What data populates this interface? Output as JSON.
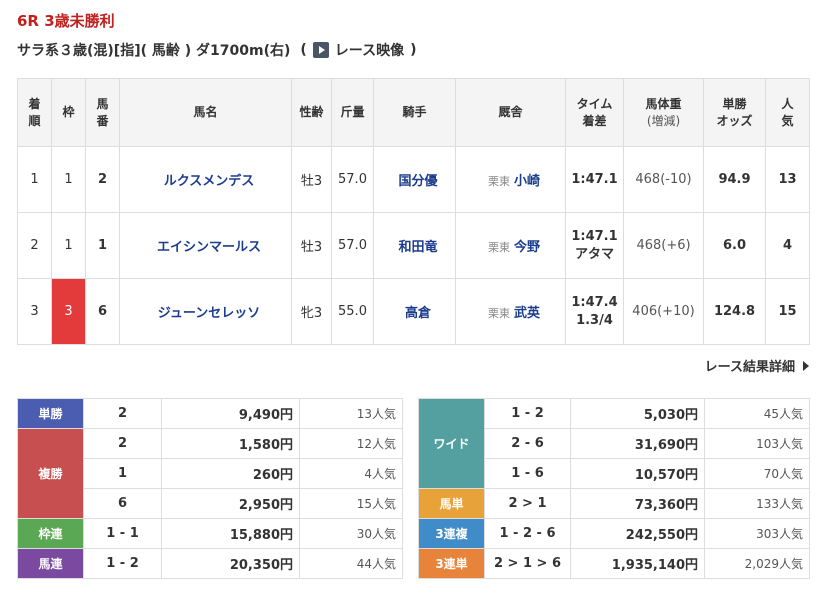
{
  "race": {
    "title": "6R 3歳未勝利",
    "conditions": "サラ系３歳(混)[指]( 馬齢 ) ダ1700m(右)",
    "paren_open": "(",
    "video_label": "レース映像",
    "paren_close": ")"
  },
  "results_table": {
    "headers": {
      "rank_1": "着",
      "rank_2": "順",
      "waku": "枠",
      "uma_1": "馬",
      "uma_2": "番",
      "horse": "馬名",
      "sexage": "性齢",
      "kinryo": "斤量",
      "jockey": "騎手",
      "trainer": "厩舎",
      "time_1": "タイム",
      "time_2": "着差",
      "weight_1": "馬体重",
      "weight_2": "(増減)",
      "odds_1": "単勝",
      "odds_2": "オッズ",
      "pop_1": "人",
      "pop_2": "気"
    },
    "rows": [
      {
        "rank": "1",
        "waku": "1",
        "uma": "2",
        "horse": "ルクスメンデス",
        "sexage": "牡3",
        "kinryo": "57.0",
        "jockey": "国分優",
        "trainer_area": "栗東",
        "trainer": "小崎",
        "time": "1:47.1",
        "margin": "",
        "weight": "468(-10)",
        "odds": "94.9",
        "pop": "13"
      },
      {
        "rank": "2",
        "waku": "1",
        "uma": "1",
        "horse": "エイシンマールス",
        "sexage": "牡3",
        "kinryo": "57.0",
        "jockey": "和田竜",
        "trainer_area": "栗東",
        "trainer": "今野",
        "time": "1:47.1",
        "margin": "アタマ",
        "weight": "468(+6)",
        "odds": "6.0",
        "pop": "4"
      },
      {
        "rank": "3",
        "waku": "3",
        "uma": "6",
        "horse": "ジューンセレッソ",
        "sexage": "牝3",
        "kinryo": "55.0",
        "jockey": "高倉",
        "trainer_area": "栗東",
        "trainer": "武英",
        "time": "1:47.4",
        "margin": "1.3/4",
        "weight": "406(+10)",
        "odds": "124.8",
        "pop": "15"
      }
    ]
  },
  "detail_link_label": "レース結果詳細",
  "payout": {
    "tansho": {
      "label": "単勝",
      "rows": [
        {
          "comb": "2",
          "amount": "9,490円",
          "pop": "13人気"
        }
      ]
    },
    "fukusho": {
      "label": "複勝",
      "rows": [
        {
          "comb": "2",
          "amount": "1,580円",
          "pop": "12人気"
        },
        {
          "comb": "1",
          "amount": "260円",
          "pop": "4人気"
        },
        {
          "comb": "6",
          "amount": "2,950円",
          "pop": "15人気"
        }
      ]
    },
    "wakuren": {
      "label": "枠連",
      "rows": [
        {
          "comb": "1 - 1",
          "amount": "15,880円",
          "pop": "30人気"
        }
      ]
    },
    "umaren": {
      "label": "馬連",
      "rows": [
        {
          "comb": "1 - 2",
          "amount": "20,350円",
          "pop": "44人気"
        }
      ]
    },
    "wide": {
      "label": "ワイド",
      "rows": [
        {
          "comb": "1 - 2",
          "amount": "5,030円",
          "pop": "45人気"
        },
        {
          "comb": "2 - 6",
          "amount": "31,690円",
          "pop": "103人気"
        },
        {
          "comb": "1 - 6",
          "amount": "10,570円",
          "pop": "70人気"
        }
      ]
    },
    "umatan": {
      "label": "馬単",
      "rows": [
        {
          "comb": "2 > 1",
          "amount": "73,360円",
          "pop": "133人気"
        }
      ]
    },
    "sanrenpuku": {
      "label": "3連複",
      "rows": [
        {
          "comb": "1 - 2 - 6",
          "amount": "242,550円",
          "pop": "303人気"
        }
      ]
    },
    "sanrentan": {
      "label": "3連単",
      "rows": [
        {
          "comb": "2 > 1 > 6",
          "amount": "1,935,140円",
          "pop": "2,029人気"
        }
      ]
    }
  },
  "colors": {
    "title_red": "#c1211e",
    "link_blue": "#1c3c8f",
    "waku3": "#e33b3b",
    "tansho": "#4a5db0",
    "fukusho": "#c84f4f",
    "wakuren": "#5aa853",
    "umaren": "#7a4aa0",
    "wide": "#54a0a0",
    "umatan": "#e8a23a",
    "sanrenpuku": "#3f8cc8",
    "sanrentan": "#e8833a"
  },
  "icons": {
    "video": "play-video-icon",
    "detail_arrow": "triangle-right-icon"
  }
}
